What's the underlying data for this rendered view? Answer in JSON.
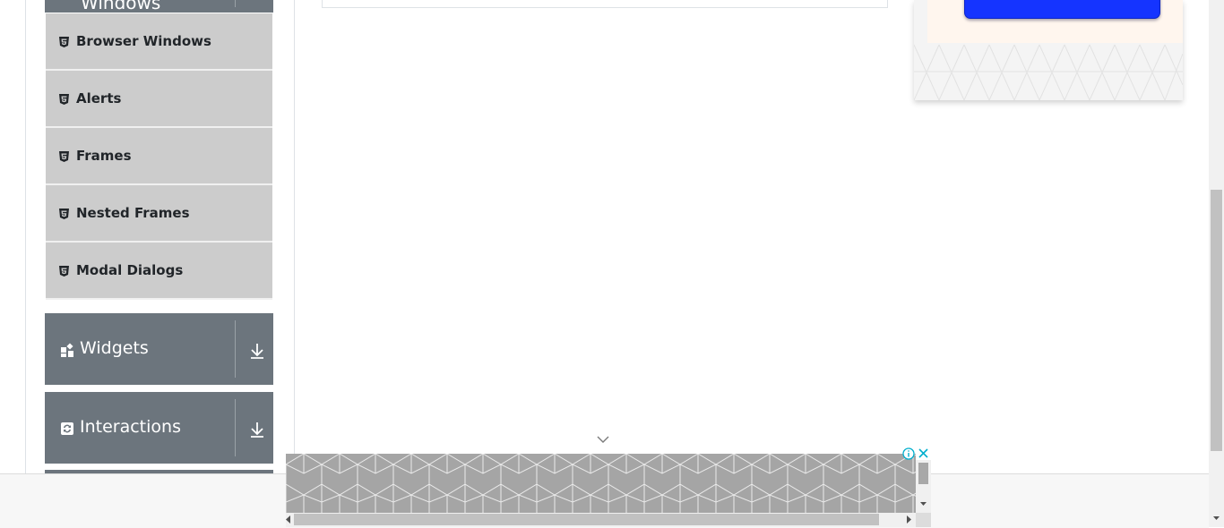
{
  "sidebar": {
    "partial_group_title": "Windows",
    "items": [
      {
        "label": "Browser Windows",
        "icon": "html5-icon"
      },
      {
        "label": "Alerts",
        "icon": "html5-icon"
      },
      {
        "label": "Frames",
        "icon": "html5-icon"
      },
      {
        "label": "Nested Frames",
        "icon": "html5-icon"
      },
      {
        "label": "Modal Dialogs",
        "icon": "html5-icon"
      }
    ],
    "groups": [
      {
        "title": "Widgets",
        "icon": "widgets-icon"
      },
      {
        "title": "Interactions",
        "icon": "interactions-icon"
      }
    ]
  },
  "colors": {
    "group_header": "#6c757d",
    "menu_item": "#cccccc",
    "ad_button": "#1534ff"
  }
}
